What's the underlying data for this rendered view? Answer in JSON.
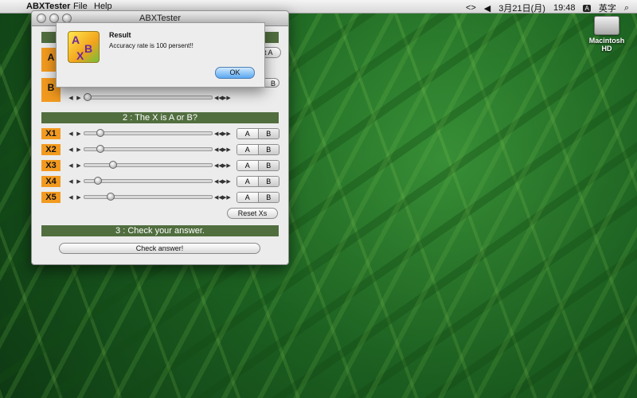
{
  "menubar": {
    "apple_icon": "apple-logo",
    "app_name": "ABXTester",
    "file": "File",
    "help": "Help",
    "status": {
      "date": "3月21日(月)",
      "time": "19:48",
      "input_method": "英字"
    }
  },
  "desktop": {
    "disk_label": "Macintosh HD"
  },
  "window": {
    "title": "ABXTester",
    "section1": {
      "sample_a_label": "A",
      "sample_b_label": "B",
      "select_a_label": "Select A",
      "select_b_label": "B"
    },
    "section2": {
      "header": "2 : The X is A or B?",
      "rows": [
        {
          "label": "X1",
          "a": "A",
          "b": "B",
          "progress": 0.12
        },
        {
          "label": "X2",
          "a": "A",
          "b": "B",
          "progress": 0.12
        },
        {
          "label": "X3",
          "a": "A",
          "b": "B",
          "progress": 0.22
        },
        {
          "label": "X4",
          "a": "A",
          "b": "B",
          "progress": 0.1
        },
        {
          "label": "X5",
          "a": "A",
          "b": "B",
          "progress": 0.2
        }
      ],
      "reset_label": "Reset Xs"
    },
    "section3": {
      "header": "3 : Check your answer.",
      "check_label": "Check answer!"
    }
  },
  "dialog": {
    "title": "Result",
    "message": "Accuracy rate is 100 persent!!",
    "ok_label": "OK",
    "icon_letters": [
      "A",
      "B",
      "X"
    ]
  },
  "colors": {
    "orange": "#f29a1f",
    "green_header": "#516e3f"
  }
}
